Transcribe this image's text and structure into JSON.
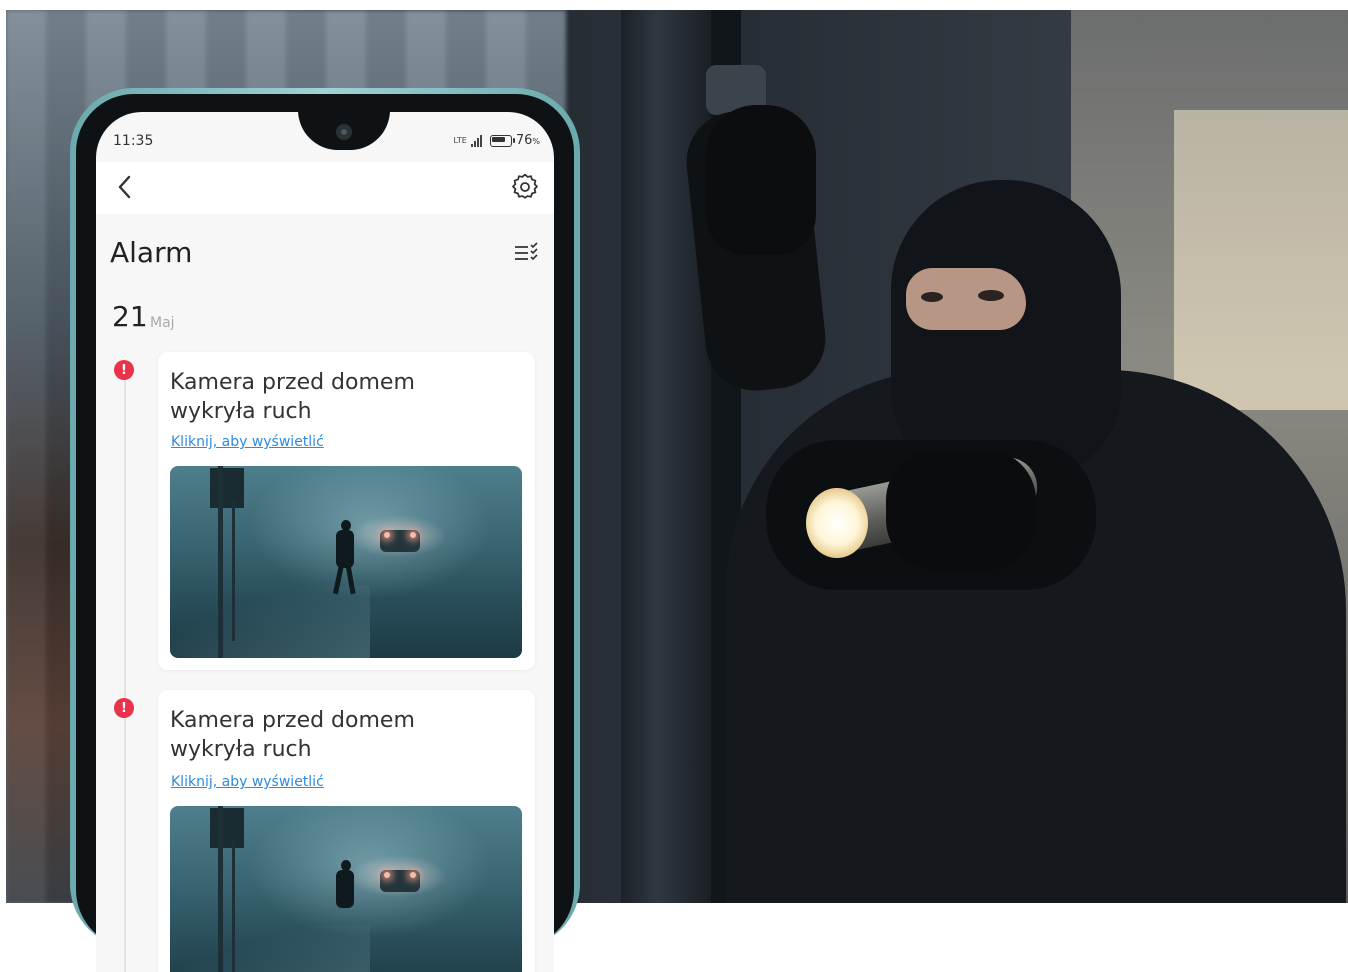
{
  "status_bar": {
    "time": "11:35",
    "network": "LTE",
    "battery": "76",
    "battery_unit": "%"
  },
  "header": {
    "back_icon": "chevron-left-icon",
    "settings_icon": "gear-icon"
  },
  "page": {
    "title": "Alarm",
    "filter_icon": "list-check-icon"
  },
  "date": {
    "day": "21",
    "month": "Maj"
  },
  "alerts": [
    {
      "title": "Kamera przed domem wykryła ruch",
      "link": "Kliknij, aby wyświetlić"
    },
    {
      "title": "Kamera przed domem wykryła ruch",
      "link": "Kliknij, aby wyświetlić"
    }
  ],
  "colors": {
    "alert_red": "#e8334a",
    "link_blue": "#2e8be0",
    "phone_frame": "#9fd3d4"
  }
}
